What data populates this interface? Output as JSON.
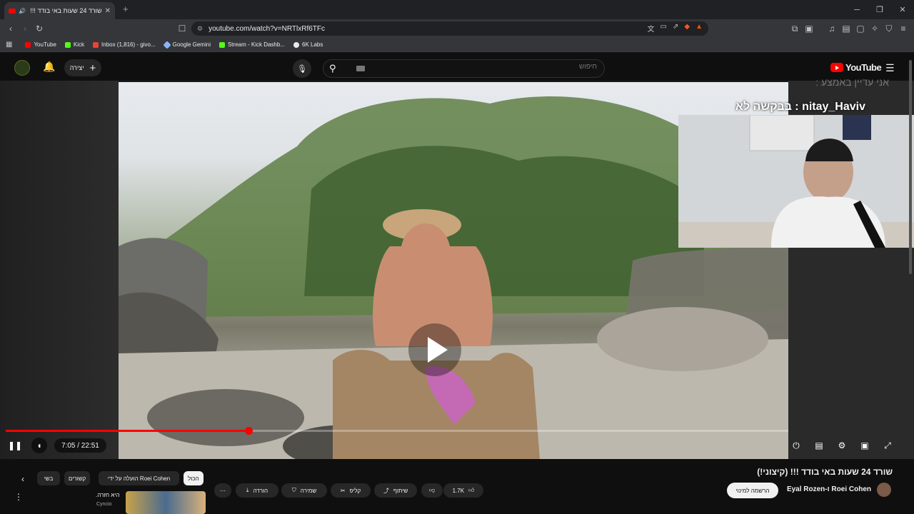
{
  "browser": {
    "tab_title": "שורד 24 שעות באי בודד !!! (קי",
    "url": "youtube.com/watch?v=NRTlxRf6TFc",
    "bookmarks": [
      {
        "label": "YouTube",
        "color": "#ff0000"
      },
      {
        "label": "Kick",
        "color": "#53fc18"
      },
      {
        "label": "Inbox (1,816) - givo...",
        "color": "#ea4335"
      },
      {
        "label": "Google Gemini",
        "color": "#8ab4f8"
      },
      {
        "label": "Stream - Kick Dashb...",
        "color": "#53fc18"
      },
      {
        "label": "6K Labs",
        "color": "#e8eaed"
      }
    ]
  },
  "youtube": {
    "logo_text": "YouTube",
    "search_placeholder": "חיפוש",
    "create_label": "יצירה"
  },
  "overlay": {
    "chat_faint": "אני עדיין באמצע : ",
    "chat_main": "nitay_Haviv : בבקשה לא"
  },
  "player": {
    "time": "7:05 / 22:51",
    "progress": 0.31
  },
  "video": {
    "title": "שורד 24 שעות באי בודד !!! (קיצוני!)",
    "channel": "Eyal Rozen-ו Roei Cohen",
    "subscribe_label": "הרשמה למינוי",
    "likes": "1.7K",
    "share_label": "שיתוף",
    "clip_label": "קליפ",
    "save_label": "שמירה",
    "download_label": "הורדה"
  },
  "chips": {
    "all": "הכול",
    "uploaded_by": "הועלה על ידי Roei Cohen",
    "related": "קשורים",
    "recent": "בשי"
  },
  "recommendation": {
    "title": "היא חזרה.",
    "channel": "Cyncio"
  }
}
